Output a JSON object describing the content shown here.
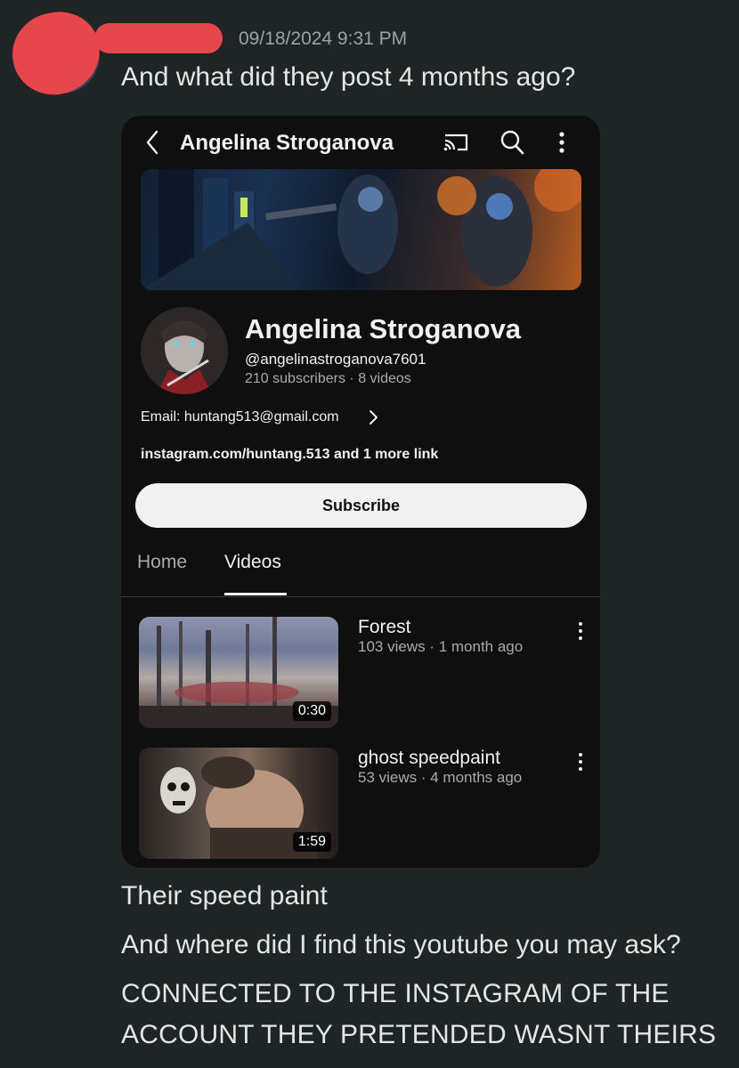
{
  "message": {
    "timestamp": "09/18/2024 9:31 PM",
    "lines": [
      "And what did they post 4 months ago?",
      "Their speed paint",
      "And where did I find this youtube you may ask?",
      "CONNECTED TO THE INSTAGRAM OF THE",
      "ACCOUNT THEY PRETENDED WASNT THEIRS"
    ]
  },
  "youtube": {
    "topbar_title": "Angelina Stroganova",
    "channel": {
      "name": "Angelina Stroganova",
      "handle": "@angelinastroganova7601",
      "subscribers": "210 subscribers",
      "separator": "·",
      "videos_count": "8 videos",
      "email": "Email: huntang513@gmail.com",
      "links": "instagram.com/huntang.513 and 1 more link"
    },
    "subscribe_label": "Subscribe",
    "tabs": [
      "Home",
      "Videos"
    ],
    "active_tab": "Videos",
    "videos": [
      {
        "title": "Forest",
        "meta": "103 views · 1 month ago",
        "duration": "0:30"
      },
      {
        "title": "ghost speedpaint",
        "meta": "53 views · 4 months ago",
        "duration": "1:59"
      }
    ]
  },
  "colors": {
    "background": "#1f2524",
    "redaction": "#e5474c",
    "youtube_background": "#0f0f0f"
  },
  "icons": [
    "back-chevron-icon",
    "cast-icon",
    "search-icon",
    "more-vertical-icon",
    "chevron-right-icon"
  ]
}
